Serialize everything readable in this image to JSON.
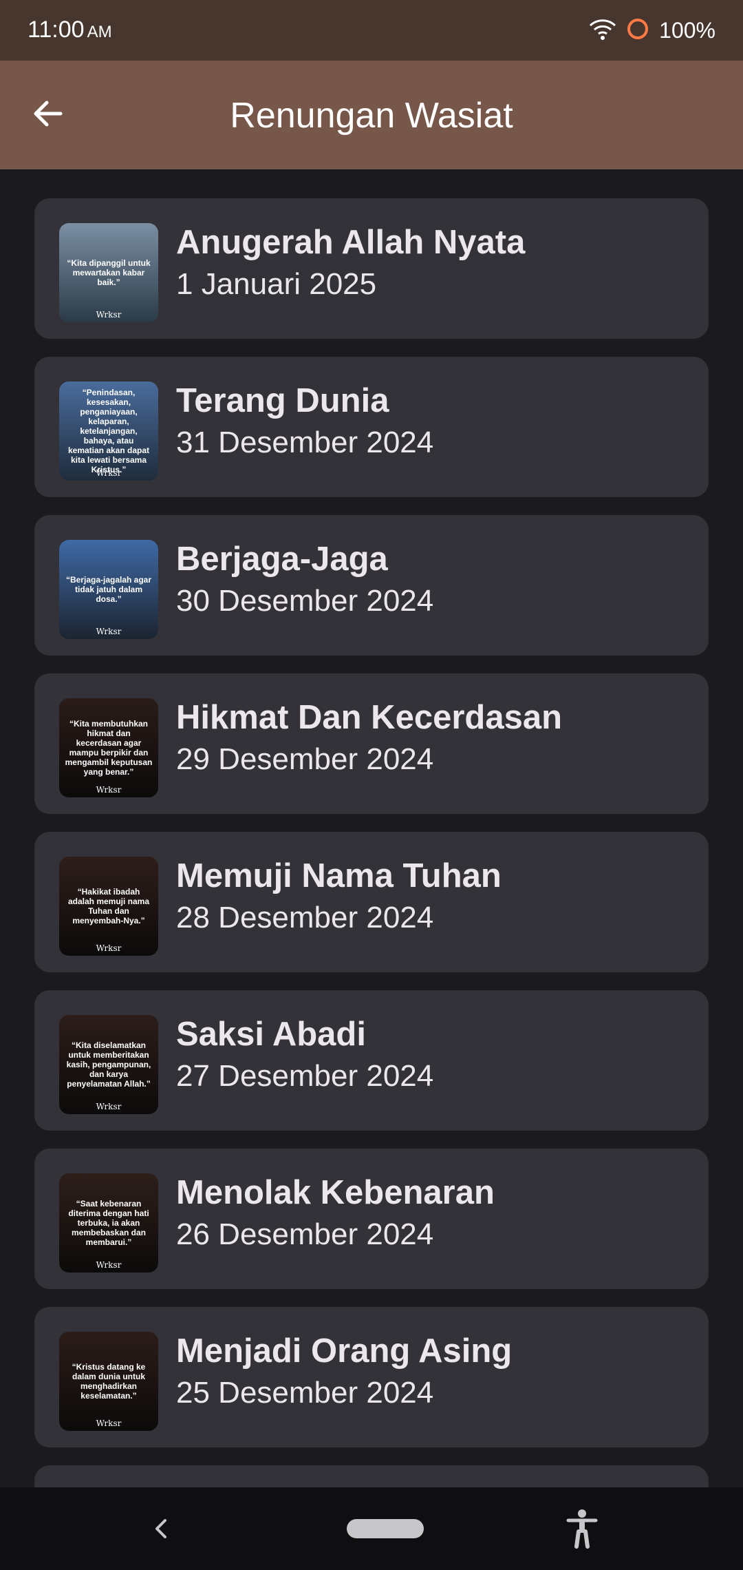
{
  "status_bar": {
    "time": "11:00",
    "ampm": "AM",
    "battery": "100%",
    "icons": [
      "wifi-icon",
      "battery-saver-icon"
    ]
  },
  "app_bar": {
    "title": "Renungan Wasiat",
    "back_icon": "arrow-left-icon"
  },
  "items": [
    {
      "title": "Anugerah Allah Nyata",
      "date": "1 Januari 2025",
      "thumb_text": "“Kita dipanggil untuk mewartakan kabar baik.”",
      "thumb_colors": [
        "#7c8fa3",
        "#2a3a48"
      ]
    },
    {
      "title": "Terang Dunia",
      "date": "31 Desember 2024",
      "thumb_text": "“Penindasan, kesesakan, penganiayaan, kelaparan, ketelanjangan, bahaya, atau kematian akan dapat kita lewati bersama Kristus.”",
      "thumb_colors": [
        "#4a6c9c",
        "#1f2c3c"
      ]
    },
    {
      "title": "Berjaga-Jaga",
      "date": "30 Desember 2024",
      "thumb_text": "“Berjaga-jagalah agar tidak jatuh dalam dosa.”",
      "thumb_colors": [
        "#3f6aa6",
        "#1c2430"
      ]
    },
    {
      "title": "Hikmat Dan Kecerdasan",
      "date": "29 Desember 2024",
      "thumb_text": "“Kita membutuhkan hikmat dan kecerdasan agar mampu berpikir dan mengambil keputusan yang benar.”",
      "thumb_colors": [
        "#2a1c18",
        "#0c0a0a"
      ]
    },
    {
      "title": "Memuji Nama Tuhan",
      "date": "28 Desember 2024",
      "thumb_text": "“Hakikat ibadah adalah memuji nama Tuhan dan menyembah-Nya.”",
      "thumb_colors": [
        "#2e1e1a",
        "#0c0a0a"
      ]
    },
    {
      "title": "Saksi Abadi",
      "date": "27 Desember 2024",
      "thumb_text": "“Kita diselamatkan untuk memberitakan kasih, pengampunan, dan karya penyelamatan Allah.”",
      "thumb_colors": [
        "#2c1d19",
        "#0c0a0a"
      ]
    },
    {
      "title": "Menolak Kebenaran",
      "date": "26 Desember 2024",
      "thumb_text": "“Saat kebenaran diterima dengan hati terbuka, ia akan membebaskan dan membarui.”",
      "thumb_colors": [
        "#2e1f1a",
        "#0c0a0a"
      ]
    },
    {
      "title": "Menjadi Orang Asing",
      "date": "25 Desember 2024",
      "thumb_text": "“Kristus datang ke dalam dunia untuk menghadirkan keselamatan.”",
      "thumb_colors": [
        "#2b1c18",
        "#0c0a0a"
      ]
    },
    {
      "title": "",
      "date": "",
      "thumb_text": "",
      "thumb_colors": [
        "#333238",
        "#333238"
      ]
    }
  ],
  "thumb_brand": "Wrksr",
  "nav_bar": {
    "icons": [
      "nav-back-icon",
      "home-pill-icon",
      "accessibility-icon"
    ]
  },
  "colors": {
    "status_bar": "#46362e",
    "app_bar": "#77574a",
    "background": "#1b1a1f",
    "card": "#333238",
    "text": "#ece7ec",
    "battery_saver": "#ff7a45"
  }
}
